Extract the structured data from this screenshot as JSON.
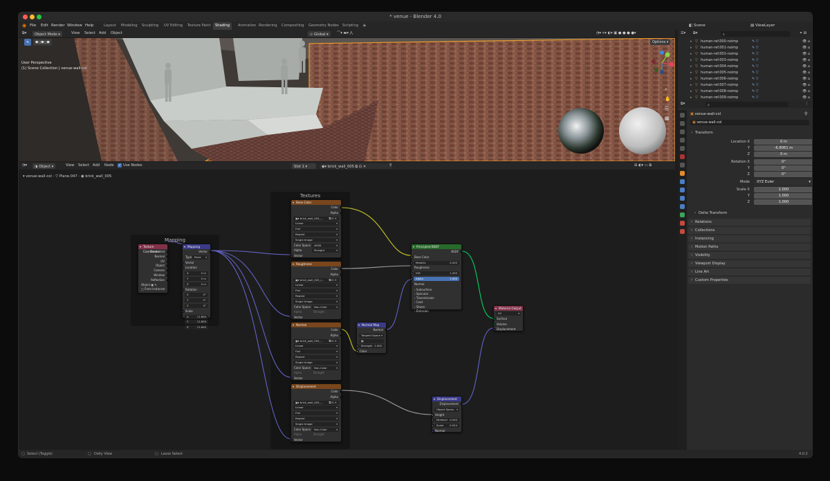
{
  "window": {
    "title": "* venue - Blender 4.0",
    "traffic_colors": [
      "#ff5f57",
      "#febc2e",
      "#28c840"
    ]
  },
  "menu": [
    "File",
    "Edit",
    "Render",
    "Window",
    "Help"
  ],
  "workspaces": [
    "Layout",
    "Modeling",
    "Sculpting",
    "UV Editing",
    "Texture Paint",
    "Shading",
    "Animation",
    "Rendering",
    "Compositing",
    "Geometry Nodes",
    "Scripting"
  ],
  "active_workspace": "Shading",
  "top_right": {
    "scene": "Scene",
    "view_layer": "ViewLayer"
  },
  "viewport": {
    "mode": "Object Mode",
    "menus": [
      "View",
      "Select",
      "Add",
      "Object"
    ],
    "transform_orientation": "Global",
    "options": "Options",
    "overlay_text": [
      "User Perspective",
      "(1) Scene Collection | venue-wall-col"
    ]
  },
  "node_editor": {
    "editor_type": "Object",
    "menus": [
      "View",
      "Select",
      "Add",
      "Node"
    ],
    "use_nodes": "Use Nodes",
    "slot": "Slot 1",
    "material": "brick_wall_005",
    "breadcrumb": [
      "venue-wall-col",
      "Plane.047",
      "brick_wall_005"
    ],
    "frames": {
      "textures": "Textures",
      "mapping": "Mapping"
    },
    "tex_coord": {
      "title": "Texture Coordinate",
      "outputs": [
        "Generated",
        "Normal",
        "UV",
        "Object",
        "Camera",
        "Window",
        "Reflection"
      ],
      "object_label": "Object",
      "from_instancer": "From Instancer"
    },
    "mapping": {
      "title": "Mapping",
      "output": "Vector",
      "type_label": "Type",
      "type_value": "Point",
      "vector": "Vector",
      "location": "Location",
      "loc": [
        {
          "axis": "X",
          "val": "0 m"
        },
        {
          "axis": "Y",
          "val": "0 m"
        },
        {
          "axis": "Z",
          "val": "0 m"
        }
      ],
      "rotation": "Rotation",
      "rot": [
        {
          "axis": "X",
          "val": "0°"
        },
        {
          "axis": "Y",
          "val": "0°"
        },
        {
          "axis": "Z",
          "val": "0°"
        }
      ],
      "scale": "Scale",
      "scl": [
        {
          "axis": "X",
          "val": "11.600"
        },
        {
          "axis": "Y",
          "val": "11.600"
        },
        {
          "axis": "Z",
          "val": "11.600"
        }
      ]
    },
    "images": [
      {
        "title": "Base Color",
        "file": "brick_wall_005_...",
        "color_space": "sRGB",
        "alpha": "Straight",
        "alpha_dim": false
      },
      {
        "title": "Roughness",
        "file": "brick_wall_005_r...",
        "color_space": "Non-Color",
        "alpha": "Straight",
        "alpha_dim": true
      },
      {
        "title": "Normal",
        "file": "brick_wall_005_...",
        "color_space": "Non-Color",
        "alpha": "Straight",
        "alpha_dim": true
      },
      {
        "title": "Displacement",
        "file": "brick_wall_005_...",
        "color_space": "Non-Color",
        "alpha": "Straight",
        "alpha_dim": true
      }
    ],
    "image_common": {
      "color": "Color",
      "alpha": "Alpha",
      "interp": "Linear",
      "proj": "Flat",
      "ext": "Repeat",
      "src": "Single Image",
      "color_space_label": "Color Space",
      "alpha_label": "Alpha",
      "vector": "Vector"
    },
    "normal_map": {
      "title": "Normal Map",
      "output": "Normal",
      "space": "Tangent Space",
      "strength_label": "Strength",
      "strength": "1.000",
      "color": "Color"
    },
    "principled": {
      "title": "Principled BSDF",
      "output": "BSDF",
      "base_color": "Base Color",
      "metallic_label": "Metallic",
      "metallic": "0.000",
      "roughness": "Roughness",
      "ior_label": "IOR",
      "ior": "1.450",
      "alpha_label": "Alpha",
      "alpha": "1.000",
      "normal": "Normal",
      "sections": [
        "Subsurface",
        "Specular",
        "Transmission",
        "Coat",
        "Sheen",
        "Emission"
      ]
    },
    "material_output": {
      "title": "Material Output",
      "target": "All",
      "inputs": [
        "Surface",
        "Volume",
        "Displacement"
      ]
    },
    "displacement": {
      "title": "Displacement",
      "output": "Displacement",
      "space": "Object Space",
      "height": "Height",
      "midlevel_label": "Midlevel",
      "midlevel": "0.000",
      "scale_label": "Scale",
      "scale": "0.024",
      "normal": "Normal"
    }
  },
  "outliner": {
    "items": [
      "human-ref.000-noimp",
      "human-ref.001-noimp",
      "human-ref.002-noimp",
      "human-ref.003-noimp",
      "human-ref.004-noimp",
      "human-ref.005-noimp",
      "human-ref.006-noimp",
      "human-ref.007-noimp",
      "human-ref.008-noimp",
      "human-ref.009-noimp"
    ]
  },
  "properties": {
    "object_name": "venue-wall-col",
    "object_field": "venue-wall-col",
    "transform": "Transform",
    "location_label": "Location X",
    "location": [
      "0 m",
      "-6.8061 m",
      "0 m"
    ],
    "rotation_label": "Rotation X",
    "rotation": [
      "0°",
      "0°",
      "0°"
    ],
    "mode_label": "Mode",
    "mode": "XYZ Euler",
    "scale_label": "Scale X",
    "scale": [
      "1.000",
      "1.000",
      "1.000"
    ],
    "axis_y": "Y",
    "axis_z": "Z",
    "delta": "Delta Transform",
    "panels": [
      "Relations",
      "Collections",
      "Instancing",
      "Motion Paths",
      "Visibility",
      "Viewport Display",
      "Line Art",
      "Custom Properties"
    ]
  },
  "status": {
    "left": "Select (Toggle)",
    "mid": "Dolly View",
    "right": "Lasso Select",
    "version": "4.0.2"
  }
}
